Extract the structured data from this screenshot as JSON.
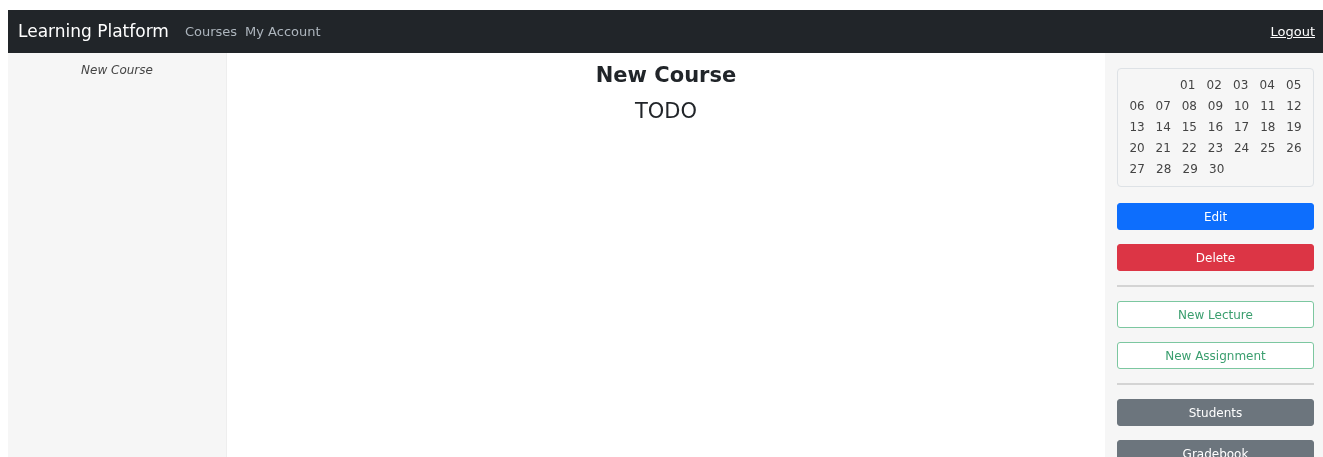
{
  "navbar": {
    "brand": "Learning Platform",
    "links": [
      "Courses",
      "My Account"
    ],
    "logout": "Logout"
  },
  "sidebar": {
    "items": [
      "New Course"
    ]
  },
  "main": {
    "title": "New Course",
    "body": "TODO"
  },
  "calendar": {
    "weeks": [
      {
        "kind": "first",
        "days": [
          "01",
          "02",
          "03",
          "04",
          "05"
        ]
      },
      {
        "kind": "full",
        "days": [
          "06",
          "07",
          "08",
          "09",
          "10",
          "11",
          "12"
        ]
      },
      {
        "kind": "full",
        "days": [
          "13",
          "14",
          "15",
          "16",
          "17",
          "18",
          "19"
        ]
      },
      {
        "kind": "full",
        "days": [
          "20",
          "21",
          "22",
          "23",
          "24",
          "25",
          "26"
        ]
      },
      {
        "kind": "last",
        "days": [
          "27",
          "28",
          "29",
          "30"
        ]
      }
    ]
  },
  "action_groups": [
    [
      {
        "label": "Edit",
        "kind": "primary"
      },
      {
        "label": "Delete",
        "kind": "danger"
      }
    ],
    [
      {
        "label": "New Lecture",
        "kind": "outline"
      },
      {
        "label": "New Assignment",
        "kind": "outline"
      }
    ],
    [
      {
        "label": "Students",
        "kind": "secondary"
      },
      {
        "label": "Gradebook",
        "kind": "secondary"
      }
    ]
  ]
}
